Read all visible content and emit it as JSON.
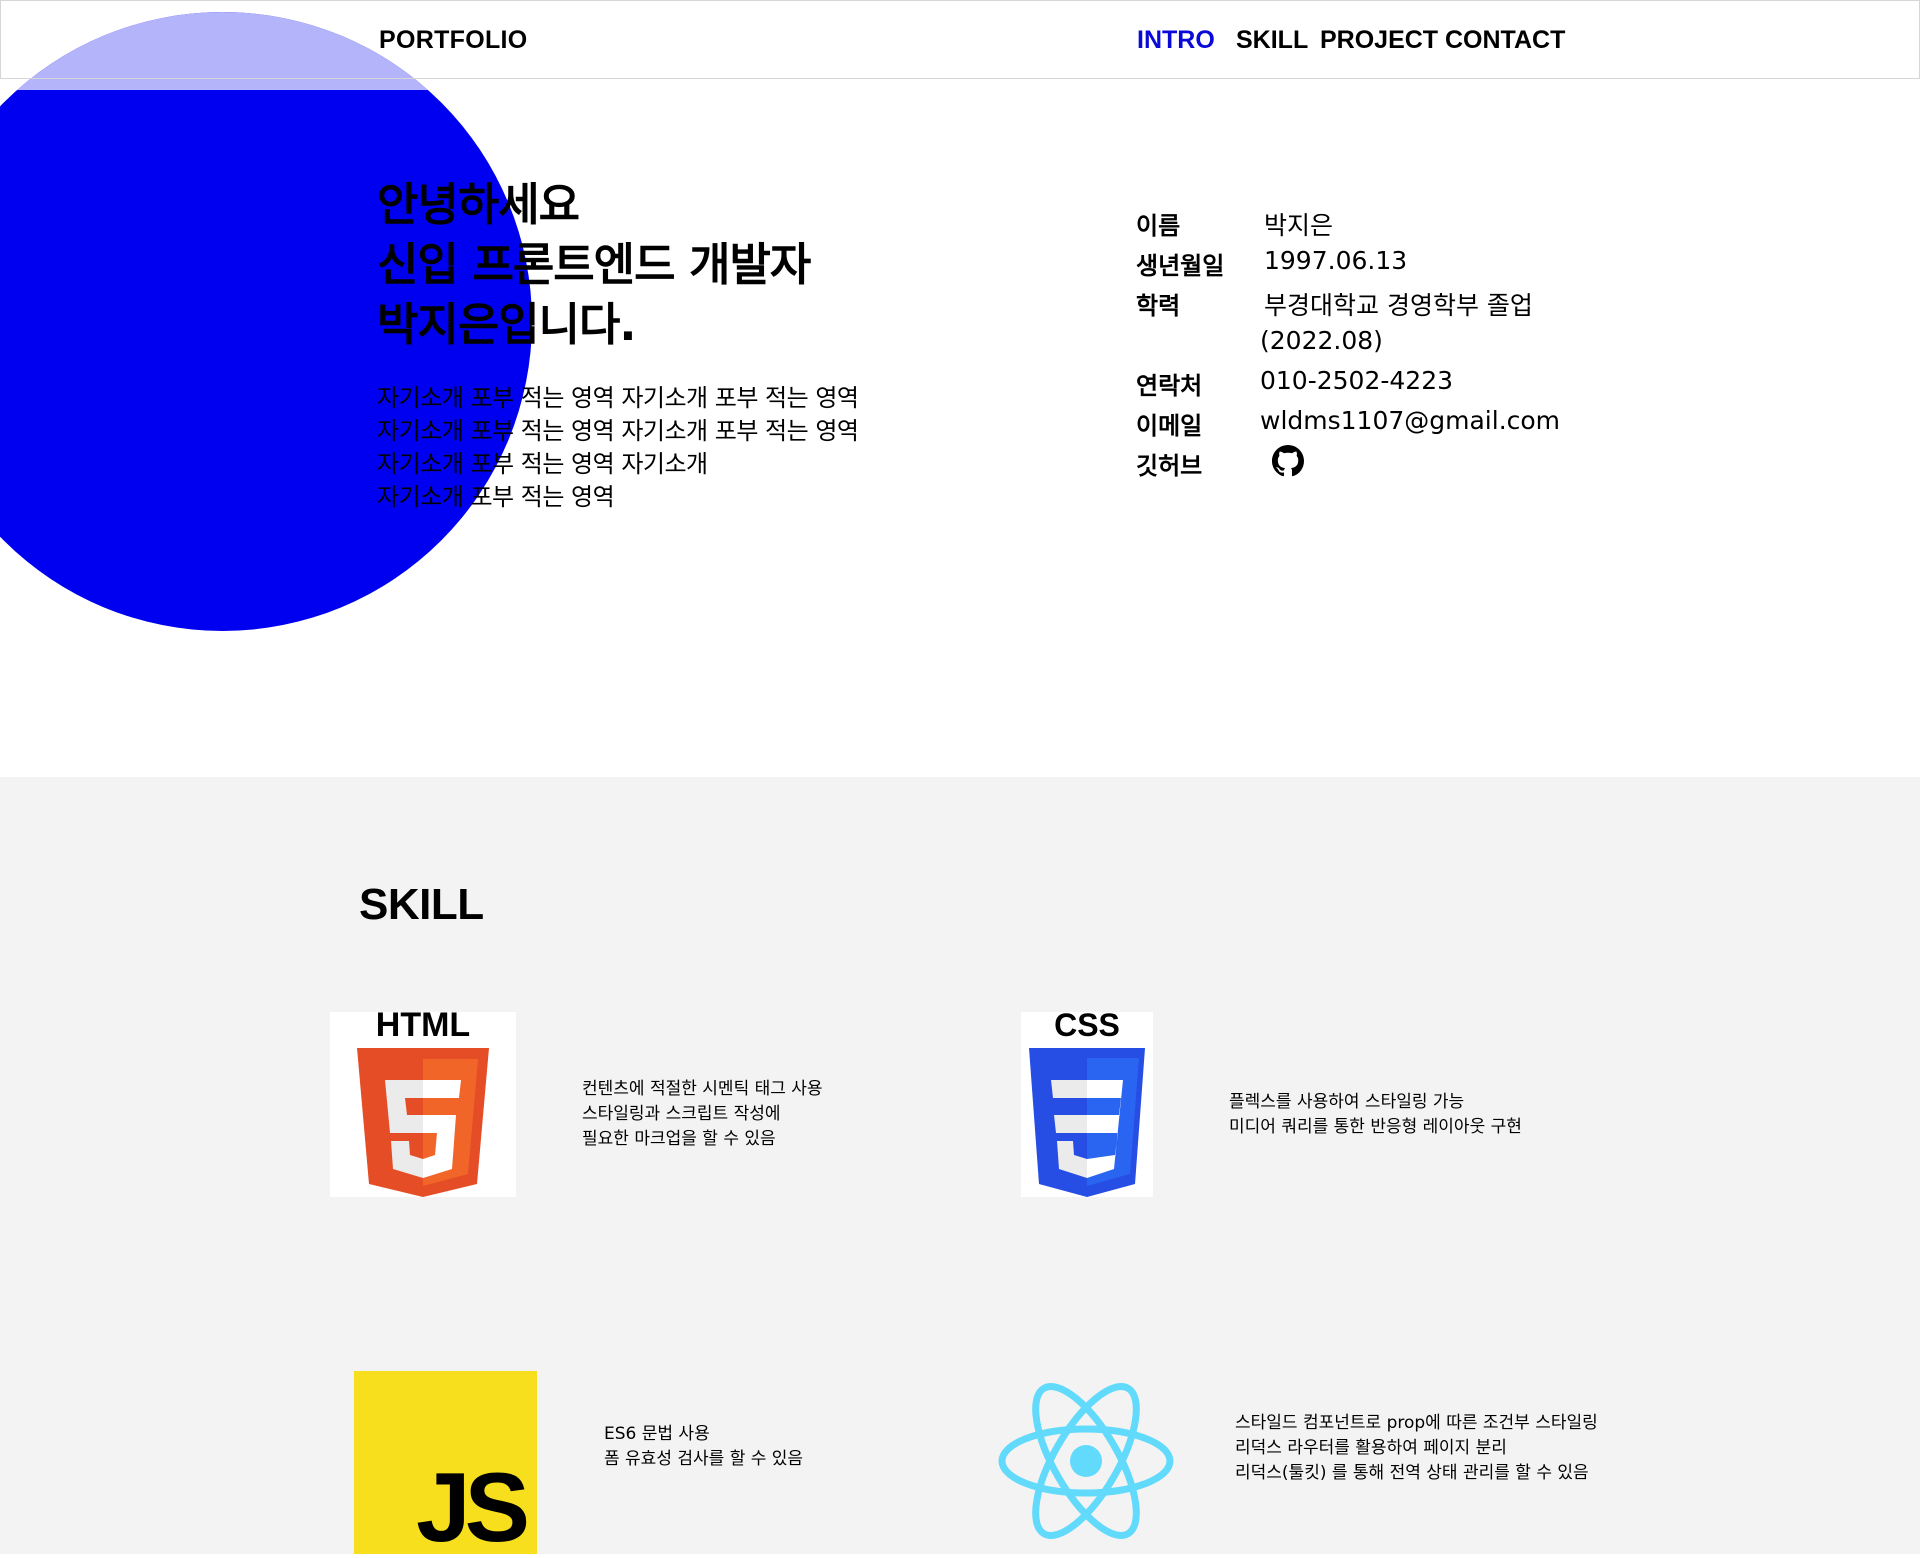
{
  "header": {
    "logo": "PORTFOLIO",
    "nav": [
      {
        "label": "INTRO",
        "active": true
      },
      {
        "label": "SKILL",
        "active": false
      },
      {
        "label": "PROJECT",
        "active": false
      },
      {
        "label": "CONTACT",
        "active": false
      }
    ],
    "active_color": "#0a0ad8"
  },
  "intro": {
    "headline": [
      "안녕하세요",
      "신입 프론트엔드 개발자",
      "박지은입니다."
    ],
    "bio": [
      "자기소개 포부 적는 영역 자기소개 포부 적는 영역",
      "자기소개 포부 적는 영역 자기소개 포부 적는 영역",
      "자기소개 포부 적는 영역 자기소개",
      "자기소개 포부 적는 영역"
    ],
    "circle_color": "#0000f0",
    "info": {
      "name_label": "이름",
      "name": "박지은",
      "birth_label": "생년월일",
      "birth": "1997.06.13",
      "edu_label": "학력",
      "edu": "부경대학교 경영학부 졸업",
      "edu_date": "(2022.08)",
      "phone_label": "연락처",
      "phone": "010-2502-4223",
      "email_label": "이메일",
      "email": "wldms1107@gmail.com",
      "github_label": "깃허브",
      "github_icon": "github-icon"
    }
  },
  "skill": {
    "title": "SKILL",
    "items": [
      {
        "logo": "html5-logo",
        "logo_text": "HTML",
        "lines": [
          "컨텐츠에 적절한 시멘틱 태그 사용",
          "스타일링과 스크립트 작성에",
          "필요한 마크업을 할 수 있음"
        ]
      },
      {
        "logo": "css3-logo",
        "logo_text": "CSS",
        "lines": [
          "플렉스를 사용하여 스타일링 가능",
          "미디어 쿼리를 통한 반응형 레이아웃 구현"
        ]
      },
      {
        "logo": "javascript-logo",
        "logo_text": "JS",
        "lines": [
          "ES6 문법 사용",
          "폼 유효성 검사를 할 수 있음"
        ]
      },
      {
        "logo": "react-logo",
        "lines": [
          "스타일드 컴포넌트로 prop에 따른 조건부 스타일링",
          "리덕스 라우터를 활용하여 페이지 분리",
          "리덕스(툴킷) 를 통해 전역 상태 관리를 할 수 있음"
        ]
      }
    ]
  }
}
